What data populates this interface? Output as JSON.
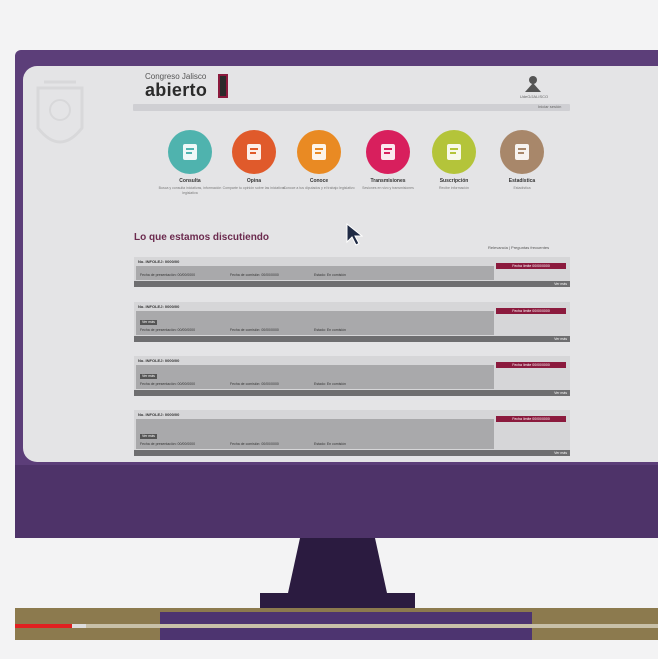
{
  "header": {
    "logo_small": "Congreso Jalisco",
    "logo_big": "abierto",
    "emblem_caption": "UdeG/JALISCO",
    "topbar_right": "Iniciar sesión"
  },
  "categories": [
    {
      "label": "Consulta",
      "desc": "Busca y consulta iniciativas, información legislativa",
      "color": "#4fb3ae",
      "icon": "search-document-icon"
    },
    {
      "label": "Opina",
      "desc": "Comparte tu opinión sobre las iniciativas",
      "color": "#e05a2b",
      "icon": "chat-bubble-icon"
    },
    {
      "label": "Conoce",
      "desc": "Conoce a tus diputados y el trabajo legislativo",
      "color": "#e98a23",
      "icon": "video-icon"
    },
    {
      "label": "Transmisiones",
      "desc": "Sesiones en vivo y transmisiones",
      "color": "#d81f5d",
      "icon": "broadcast-icon"
    },
    {
      "label": "Suscripción",
      "desc": "Recibe información",
      "color": "#b4c43a",
      "icon": "subscribe-icon"
    },
    {
      "label": "Estadística",
      "desc": "Estadística",
      "color": "#a8876a",
      "icon": "chart-doc-icon"
    }
  ],
  "section": {
    "title": "Lo que estamos discutiendo",
    "sort_link": "Relevancia | Preguntas frecuentes"
  },
  "discussions": [
    {
      "id": "No. INFOLEJ: 0000/00",
      "deadline": "Fecha límite 00/00/0000",
      "tag": "",
      "meta": [
        "Fecha de presentación: 00/00/0000",
        "Fecha de comisión: 00/00/0000",
        "Estado: En comisión"
      ],
      "footer": "Ver más"
    },
    {
      "id": "No. INFOLEJ: 0000/00",
      "deadline": "Fecha límite 00/00/0000",
      "tag": "Ver más",
      "meta": [
        "Fecha de presentación: 00/00/0000",
        "Fecha de comisión: 00/00/0000",
        "Estado: En comisión"
      ],
      "footer": "Ver más"
    },
    {
      "id": "No. INFOLEJ: 0000/00",
      "deadline": "Fecha límite 00/00/0000",
      "tag": "Ver más",
      "meta": [
        "Fecha de presentación: 00/00/0000",
        "Fecha de comisión: 00/00/0000",
        "Estado: En comisión"
      ],
      "footer": "Ver más"
    },
    {
      "id": "No. INFOLEJ: 0000/00",
      "deadline": "Fecha límite 00/00/0000",
      "tag": "Ver más",
      "meta": [
        "Fecha de presentación: 00/00/0000",
        "Fecha de comisión: 00/00/0000",
        "Estado: En comisión"
      ],
      "footer": "Ver más"
    }
  ],
  "video": {
    "progress": 0.09
  },
  "colors": {
    "bezel": "#5c3e79",
    "accent": "#8b1a3d",
    "progress": "#e02020"
  }
}
